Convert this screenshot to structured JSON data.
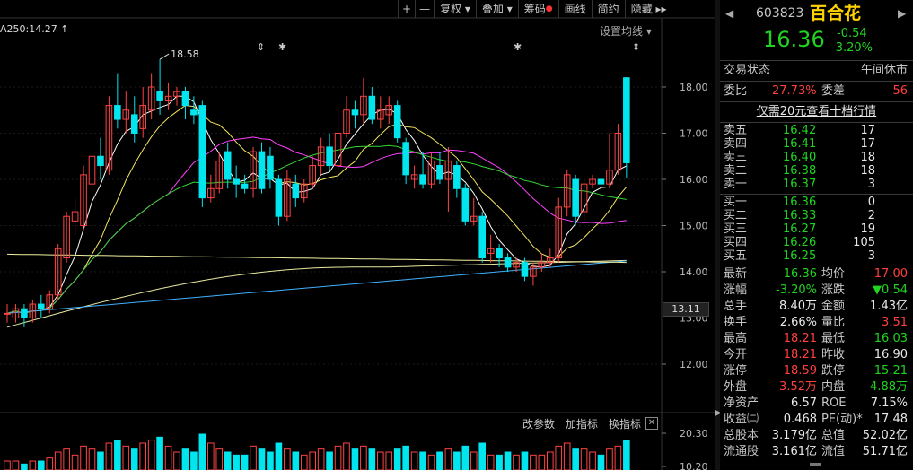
{
  "toolbar": {
    "zoom_in": "+",
    "zoom_out": "—",
    "fq": "复权",
    "overlay": "叠加",
    "chips": "筹码",
    "draw": "画线",
    "simple": "简约",
    "hide": "隐藏",
    "more": "▸▸"
  },
  "chart": {
    "ma_label": "A250:14.27",
    "ma_setting": "设置均线",
    "high_marker": "18.58",
    "current_price_tag": "13.11",
    "y_ticks": [
      "18.00",
      "17.00",
      "16.00",
      "15.00",
      "14.00",
      "13.00",
      "12.00"
    ],
    "sub_y_ticks": [
      "20.30",
      "10.20"
    ],
    "sub_toolbar": [
      "改参数",
      "加指标",
      "换指标"
    ],
    "sub_close": "✕",
    "colors": {
      "up": "#ff4444",
      "down": "#00e5ee",
      "ma5": "#ffffff",
      "ma10": "#f5e664",
      "ma20": "#ff40ff",
      "ma30": "#33d633",
      "ma60": "#e8e8a0",
      "ma120": "#3fb0ff",
      "ma250": "#f0f0a0"
    }
  },
  "candles": [
    {
      "o": 13.1,
      "c": 13.1,
      "h": 13.3,
      "l": 12.9
    },
    {
      "o": 13.0,
      "c": 13.2,
      "h": 13.3,
      "l": 12.9
    },
    {
      "o": 13.2,
      "c": 13.0,
      "h": 13.3,
      "l": 12.8
    },
    {
      "o": 13.0,
      "c": 13.3,
      "h": 13.4,
      "l": 12.9
    },
    {
      "o": 13.3,
      "c": 13.2,
      "h": 13.5,
      "l": 13.0
    },
    {
      "o": 13.2,
      "c": 13.5,
      "h": 13.6,
      "l": 13.1
    },
    {
      "o": 13.5,
      "c": 14.5,
      "h": 14.6,
      "l": 13.4
    },
    {
      "o": 14.3,
      "c": 15.2,
      "h": 15.3,
      "l": 14.2
    },
    {
      "o": 15.1,
      "c": 15.3,
      "h": 15.6,
      "l": 14.8
    },
    {
      "o": 15.0,
      "c": 16.1,
      "h": 16.3,
      "l": 14.9
    },
    {
      "o": 15.9,
      "c": 16.5,
      "h": 16.8,
      "l": 15.7
    },
    {
      "o": 16.5,
      "c": 16.3,
      "h": 16.9,
      "l": 16.0
    },
    {
      "o": 16.2,
      "c": 17.6,
      "h": 17.8,
      "l": 16.1
    },
    {
      "o": 17.6,
      "c": 17.3,
      "h": 18.3,
      "l": 17.1
    },
    {
      "o": 17.3,
      "c": 17.5,
      "h": 17.9,
      "l": 17.0
    },
    {
      "o": 17.4,
      "c": 17.0,
      "h": 17.8,
      "l": 16.8
    },
    {
      "o": 17.1,
      "c": 17.6,
      "h": 18.0,
      "l": 16.9
    },
    {
      "o": 17.5,
      "c": 18.0,
      "h": 18.3,
      "l": 17.3
    },
    {
      "o": 17.9,
      "c": 17.7,
      "h": 18.6,
      "l": 17.4
    },
    {
      "o": 17.7,
      "c": 17.8,
      "h": 18.1,
      "l": 17.5
    },
    {
      "o": 17.8,
      "c": 17.9,
      "h": 18.0,
      "l": 17.6
    },
    {
      "o": 17.9,
      "c": 17.6,
      "h": 18.0,
      "l": 17.3
    },
    {
      "o": 17.5,
      "c": 17.4,
      "h": 17.8,
      "l": 17.2
    },
    {
      "o": 17.6,
      "c": 15.6,
      "h": 17.7,
      "l": 15.4
    },
    {
      "o": 15.6,
      "c": 15.8,
      "h": 16.1,
      "l": 15.5
    },
    {
      "o": 15.8,
      "c": 16.4,
      "h": 16.6,
      "l": 15.7
    },
    {
      "o": 16.6,
      "c": 16.0,
      "h": 16.8,
      "l": 15.8
    },
    {
      "o": 16.0,
      "c": 15.9,
      "h": 16.3,
      "l": 15.6
    },
    {
      "o": 15.9,
      "c": 15.8,
      "h": 16.1,
      "l": 15.7
    },
    {
      "o": 15.8,
      "c": 16.6,
      "h": 16.7,
      "l": 15.6
    },
    {
      "o": 16.6,
      "c": 15.8,
      "h": 16.8,
      "l": 15.7
    },
    {
      "o": 16.5,
      "c": 16.0,
      "h": 16.7,
      "l": 15.8
    },
    {
      "o": 16.0,
      "c": 15.2,
      "h": 16.1,
      "l": 15.0
    },
    {
      "o": 15.2,
      "c": 16.0,
      "h": 16.2,
      "l": 15.1
    },
    {
      "o": 15.9,
      "c": 15.6,
      "h": 16.1,
      "l": 15.4
    },
    {
      "o": 15.6,
      "c": 15.9,
      "h": 16.0,
      "l": 15.5
    },
    {
      "o": 15.9,
      "c": 16.3,
      "h": 16.5,
      "l": 15.8
    },
    {
      "o": 16.3,
      "c": 16.7,
      "h": 16.9,
      "l": 16.1
    },
    {
      "o": 16.7,
      "c": 16.3,
      "h": 17.0,
      "l": 16.2
    },
    {
      "o": 16.3,
      "c": 17.0,
      "h": 17.6,
      "l": 16.2
    },
    {
      "o": 17.0,
      "c": 17.5,
      "h": 17.8,
      "l": 16.9
    },
    {
      "o": 17.5,
      "c": 17.4,
      "h": 17.7,
      "l": 17.1
    },
    {
      "o": 17.4,
      "c": 17.8,
      "h": 18.2,
      "l": 17.2
    },
    {
      "o": 17.8,
      "c": 17.3,
      "h": 18.0,
      "l": 17.2
    },
    {
      "o": 17.3,
      "c": 17.5,
      "h": 17.8,
      "l": 17.1
    },
    {
      "o": 17.4,
      "c": 17.6,
      "h": 17.8,
      "l": 17.2
    },
    {
      "o": 17.6,
      "c": 16.9,
      "h": 17.7,
      "l": 16.8
    },
    {
      "o": 16.8,
      "c": 16.1,
      "h": 16.9,
      "l": 15.9
    },
    {
      "o": 16.0,
      "c": 16.1,
      "h": 16.3,
      "l": 15.8
    },
    {
      "o": 16.1,
      "c": 15.9,
      "h": 16.6,
      "l": 15.8
    },
    {
      "o": 15.9,
      "c": 16.4,
      "h": 16.6,
      "l": 15.8
    },
    {
      "o": 16.3,
      "c": 16.0,
      "h": 16.6,
      "l": 15.9
    },
    {
      "o": 16.0,
      "c": 16.4,
      "h": 16.7,
      "l": 15.3
    },
    {
      "o": 16.3,
      "c": 15.8,
      "h": 16.4,
      "l": 15.6
    },
    {
      "o": 15.8,
      "c": 15.1,
      "h": 15.9,
      "l": 15.0
    },
    {
      "o": 15.1,
      "c": 15.2,
      "h": 15.6,
      "l": 15.0
    },
    {
      "o": 15.2,
      "c": 14.3,
      "h": 15.3,
      "l": 14.2
    },
    {
      "o": 14.4,
      "c": 14.5,
      "h": 14.8,
      "l": 14.2
    },
    {
      "o": 14.5,
      "c": 14.3,
      "h": 14.6,
      "l": 14.1
    },
    {
      "o": 14.3,
      "c": 14.1,
      "h": 14.4,
      "l": 14.0
    },
    {
      "o": 14.1,
      "c": 14.2,
      "h": 14.3,
      "l": 14.0
    },
    {
      "o": 14.2,
      "c": 13.9,
      "h": 14.3,
      "l": 13.8
    },
    {
      "o": 13.9,
      "c": 14.1,
      "h": 14.2,
      "l": 13.7
    },
    {
      "o": 14.1,
      "c": 14.2,
      "h": 14.4,
      "l": 14.0
    },
    {
      "o": 14.2,
      "c": 14.3,
      "h": 14.5,
      "l": 14.1
    },
    {
      "o": 14.3,
      "c": 15.4,
      "h": 15.6,
      "l": 14.2
    },
    {
      "o": 15.4,
      "c": 16.1,
      "h": 16.2,
      "l": 15.2
    },
    {
      "o": 16.0,
      "c": 15.2,
      "h": 16.1,
      "l": 15.0
    },
    {
      "o": 15.3,
      "c": 15.9,
      "h": 16.0,
      "l": 15.1
    },
    {
      "o": 15.9,
      "c": 16.0,
      "h": 16.1,
      "l": 15.8
    },
    {
      "o": 16.0,
      "c": 15.9,
      "h": 16.1,
      "l": 15.7
    },
    {
      "o": 15.9,
      "c": 16.2,
      "h": 17.0,
      "l": 15.8
    },
    {
      "o": 16.2,
      "c": 17.0,
      "h": 17.2,
      "l": 16.1
    },
    {
      "o": 18.2,
      "c": 16.36,
      "h": 18.21,
      "l": 16.03
    }
  ],
  "volumes": [
    3,
    3,
    2,
    3,
    3,
    4,
    6,
    7,
    5,
    8,
    7,
    6,
    9,
    10,
    8,
    7,
    9,
    10,
    11,
    8,
    6,
    7,
    6,
    12,
    9,
    7,
    6,
    5,
    5,
    8,
    7,
    6,
    9,
    7,
    6,
    5,
    6,
    7,
    6,
    8,
    9,
    7,
    8,
    7,
    6,
    6,
    7,
    8,
    6,
    6,
    5,
    6,
    7,
    6,
    8,
    6,
    9,
    5,
    5,
    6,
    5,
    6,
    5,
    5,
    6,
    8,
    9,
    7,
    7,
    6,
    5,
    7,
    8,
    10
  ],
  "quote": {
    "code": "603823",
    "name": "百合花",
    "price": "16.36",
    "change": "-0.54",
    "change_pct": "-3.20%",
    "status_label": "交易状态",
    "status_value": "午间休市",
    "weibi_label": "委比",
    "weibi_value": "27.73%",
    "weicha_label": "委差",
    "weicha_value": "56",
    "level2_link": "仅需20元查看十档行情",
    "asks": [
      {
        "label": "卖五",
        "price": "16.42",
        "vol": "17"
      },
      {
        "label": "卖四",
        "price": "16.41",
        "vol": "17"
      },
      {
        "label": "卖三",
        "price": "16.40",
        "vol": "18"
      },
      {
        "label": "卖二",
        "price": "16.38",
        "vol": "18"
      },
      {
        "label": "卖一",
        "price": "16.37",
        "vol": "3"
      }
    ],
    "bids": [
      {
        "label": "买一",
        "price": "16.36",
        "vol": "0"
      },
      {
        "label": "买二",
        "price": "16.33",
        "vol": "2"
      },
      {
        "label": "买三",
        "price": "16.27",
        "vol": "19"
      },
      {
        "label": "买四",
        "price": "16.26",
        "vol": "105"
      },
      {
        "label": "买五",
        "price": "16.25",
        "vol": "3"
      }
    ],
    "stats": [
      {
        "l1": "最新",
        "v1": "16.36",
        "c1": "green",
        "l2": "均价",
        "v2": "17.00",
        "c2": "red"
      },
      {
        "l1": "涨幅",
        "v1": "-3.20%",
        "c1": "green",
        "l2": "涨跌",
        "v2": "▼0.54",
        "c2": "green"
      },
      {
        "l1": "总手",
        "v1": "8.40万",
        "c1": "white",
        "l2": "金额",
        "v2": "1.43亿",
        "c2": "white"
      },
      {
        "l1": "换手",
        "v1": "2.66%",
        "c1": "white",
        "l2": "量比",
        "v2": "3.51",
        "c2": "red"
      },
      {
        "l1": "最高",
        "v1": "18.21",
        "c1": "red",
        "l2": "最低",
        "v2": "16.03",
        "c2": "green"
      },
      {
        "l1": "今开",
        "v1": "18.21",
        "c1": "red",
        "l2": "昨收",
        "v2": "16.90",
        "c2": "white"
      },
      {
        "l1": "涨停",
        "v1": "18.59",
        "c1": "red",
        "l2": "跌停",
        "v2": "15.21",
        "c2": "green"
      },
      {
        "l1": "外盘",
        "v1": "3.52万",
        "c1": "red",
        "l2": "内盘",
        "v2": "4.88万",
        "c2": "green"
      },
      {
        "l1": "净资产",
        "v1": "6.57",
        "c1": "white",
        "l2": "ROE",
        "v2": "7.15%",
        "c2": "white"
      },
      {
        "l1": "收益㈡",
        "v1": "0.468",
        "c1": "white",
        "l2": "PE(动)*",
        "v2": "17.48",
        "c2": "white"
      },
      {
        "l1": "总股本",
        "v1": "3.179亿",
        "c1": "white",
        "l2": "总值",
        "v2": "52.02亿",
        "c2": "white"
      },
      {
        "l1": "流通股",
        "v1": "3.161亿",
        "c1": "white",
        "l2": "流值",
        "v2": "51.71亿",
        "c2": "white"
      }
    ]
  }
}
